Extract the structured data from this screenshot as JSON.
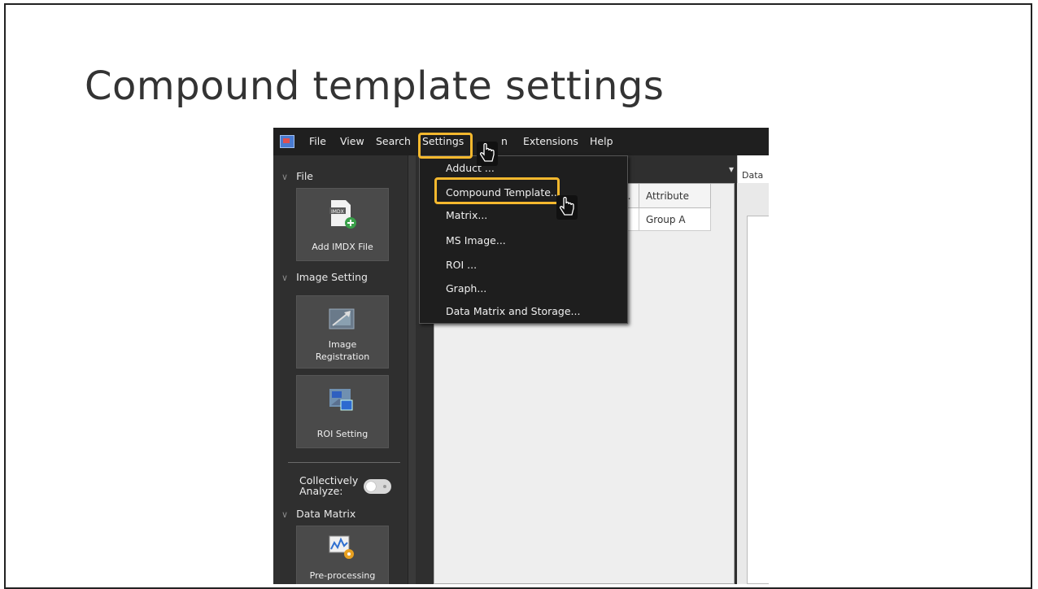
{
  "slide": {
    "title": "Compound template settings"
  },
  "menubar": {
    "items": [
      "File",
      "View",
      "Search",
      "Settings",
      "n",
      "Extensions",
      "Help"
    ]
  },
  "sidebar": {
    "sections": {
      "file": "File",
      "image_setting": "Image Setting",
      "data_matrix": "Data Matrix"
    },
    "tiles": {
      "add_imdx": "Add IMDX File",
      "image_registration_1": "Image",
      "image_registration_2": "Registration",
      "roi_setting": "ROI Setting",
      "preprocessing": "Pre-processing"
    },
    "icon_text": "IMDX",
    "collectively_1": "Collectively",
    "collectively_2": "Analyze:"
  },
  "table": {
    "headers": [
      "...",
      "Attribute"
    ],
    "rows": [
      [
        "Group A"
      ]
    ]
  },
  "right_panel": {
    "tab_label": "Data"
  },
  "dropdown": {
    "items": [
      "Adduct ...",
      "Compound Template...",
      "Matrix...",
      "MS Image...",
      "ROI ...",
      "Graph...",
      "Data Matrix and Storage..."
    ]
  },
  "colors": {
    "highlight": "#f5b82e",
    "menubar": "#1f1f1f",
    "sidebar": "#2f2f2f"
  }
}
